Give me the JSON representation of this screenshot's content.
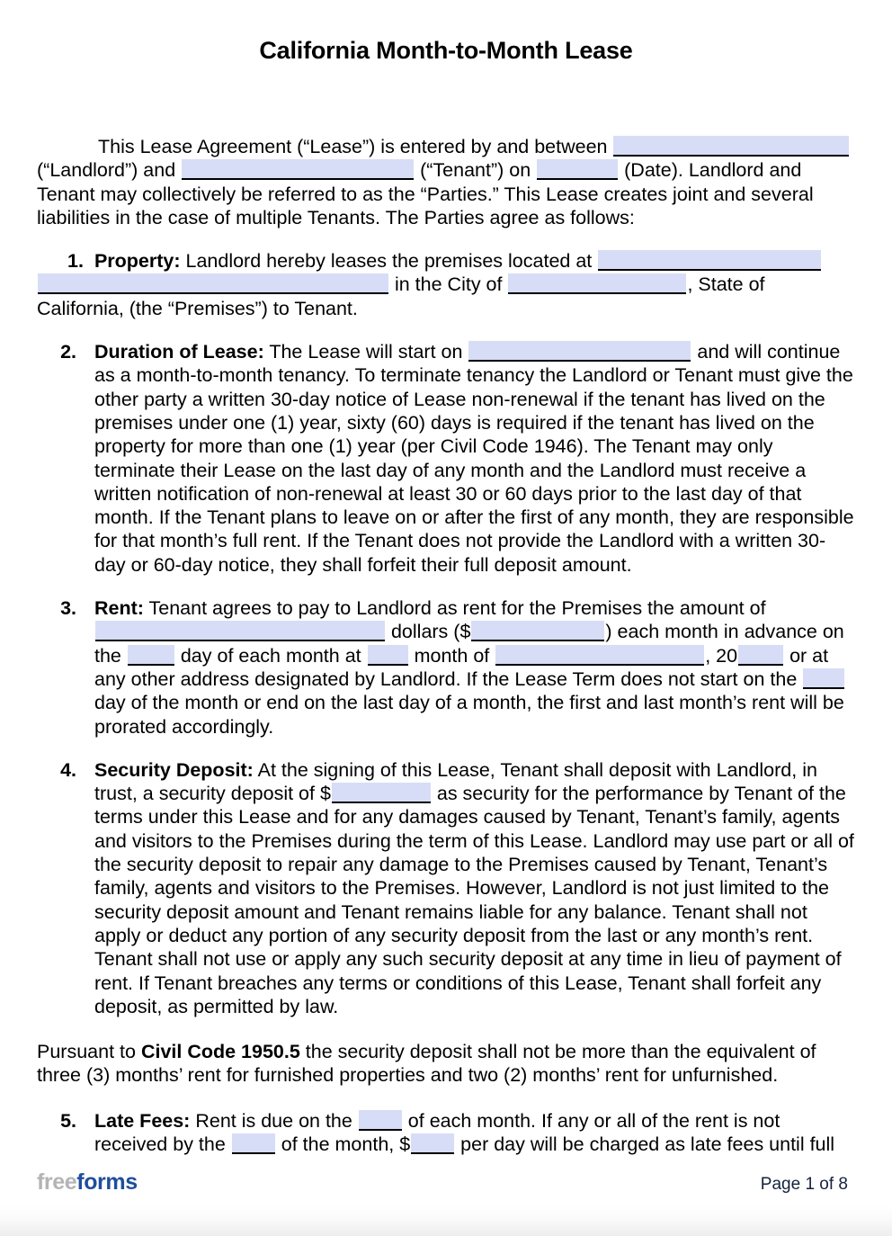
{
  "document": {
    "title": "California Month-to-Month Lease",
    "intro": {
      "t1": "This Lease Agreement (“Lease”) is entered by and between ",
      "t2": " (“Landlord”) and ",
      "t3": " (“Tenant”) on ",
      "t4": " (Date).  Landlord and Tenant may collectively be referred to as the “Parties.”  This Lease creates joint and several liabilities in the case of multiple Tenants.  The Parties agree as follows:"
    },
    "sections": [
      {
        "number": "1.",
        "label": "Property:",
        "t1": " Landlord hereby leases the premises located at ",
        "t2": " in the City of ",
        "t3": ", State of California, (the “Premises”) to Tenant."
      },
      {
        "number": "2.",
        "label": "Duration of Lease:",
        "t1": "  The Lease will start on ",
        "t2": " and will continue as a month-to-month tenancy. To terminate tenancy the Landlord or Tenant must give the other party a written 30-day notice of Lease non-renewal if the tenant has lived on the premises under one (1) year, sixty (60) days is required if the tenant has lived on the property for more than one (1) year (per Civil Code 1946). The Tenant may only terminate their Lease on the last day of any month and the Landlord must receive a written notification of non-renewal at least 30 or 60 days prior to the last day of that month. If the Tenant plans to leave on or after the first of any month, they are responsible for that month’s full rent. If the Tenant does not provide the Landlord with a written 30-day or 60-day notice, they shall forfeit their full deposit amount."
      },
      {
        "number": "3.",
        "label": "Rent:",
        "t1": "  Tenant agrees to pay to Landlord as rent for the Premises the amount of ",
        "t2": " dollars ($",
        "t3": ") each month in advance on the ",
        "t4": " day of each month at ",
        "t5": " month of ",
        "t6": ", 20",
        "t7": " or at any other address designated by Landlord.  If the Lease Term does not start on the ",
        "t8": " day of the month or end on the last day of a month, the first and last month’s rent will be prorated accordingly."
      },
      {
        "number": "4.",
        "label": "Security Deposit:",
        "t1": "  At the signing of this Lease, Tenant shall deposit with Landlord, in trust, a security deposit of $",
        "t2": " as security for the performance by Tenant of the terms under this Lease and for any damages caused by Tenant, Tenant’s family, agents and visitors to the Premises during the term of this Lease. Landlord may use part or all of the security deposit to repair any damage to the Premises caused by Tenant, Tenant’s family, agents and visitors to the Premises. However, Landlord is not just limited to the security deposit amount and Tenant remains liable for any balance. Tenant shall not apply or deduct any portion of any security deposit from the last or any month’s rent.  Tenant shall not use or apply any such security deposit at any time in lieu of payment of rent.  If Tenant breaches any terms or conditions of this Lease, Tenant shall forfeit any deposit, as permitted by law."
      },
      {
        "number": "5.",
        "label": "Late Fees:",
        "t1": " Rent is due on the ",
        "t2": " of each month.  If any or all of the rent is not received by the ",
        "t3": " of the month, $",
        "t4": " per day will be charged as late fees until full"
      }
    ],
    "civil_code_note": {
      "t1": "Pursuant to ",
      "bold": "Civil Code 1950.5",
      "t2": " the security deposit shall not be more than the equivalent of three (3) months’ rent for furnished properties and two (2) months’ rent for unfurnished."
    },
    "footer": {
      "logo_first": "free",
      "logo_second": "forms",
      "page_label": "Page 1 of 8"
    },
    "colors": {
      "form_field_fill": "#d7ddf6",
      "logo_gray": "#b4b4b4",
      "logo_blue": "#1f4e9c",
      "page_number": "#15213f",
      "text": "#000000"
    }
  }
}
